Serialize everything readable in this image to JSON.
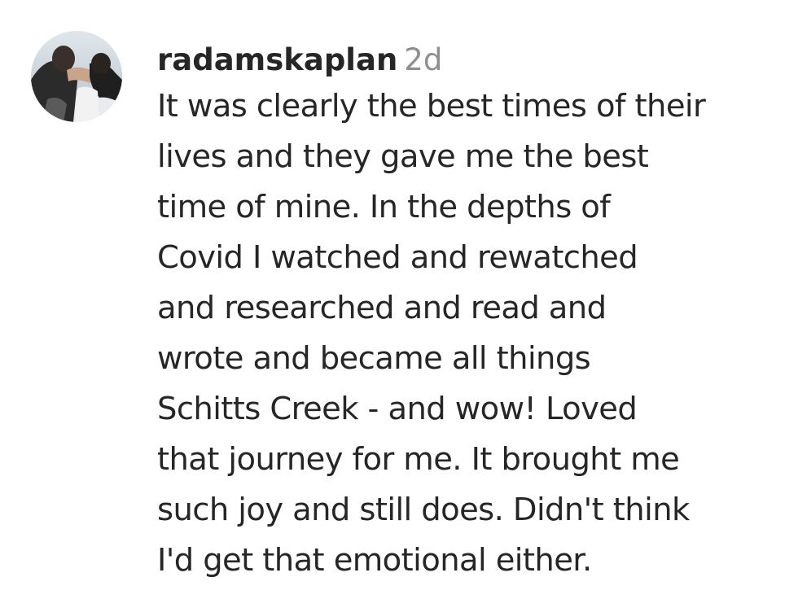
{
  "comment": {
    "avatar_icon": "user-avatar-photo",
    "username": "radamskaplan",
    "time_ago": "2d",
    "text_lines": [
      "It was clearly the best times of their",
      "lives and they gave me the best",
      "time of mine. In the depths of",
      "Covid I watched and rewatched",
      "and researched and read and",
      "wrote and became all things",
      "Schitts Creek - and wow! Loved",
      "that journey for me. It brought me",
      "such joy and still does. Didn't think",
      "I'd get that emotional either."
    ]
  },
  "colors": {
    "username": "#262626",
    "timestamp": "#8e8e8e",
    "background": "#ffffff"
  }
}
